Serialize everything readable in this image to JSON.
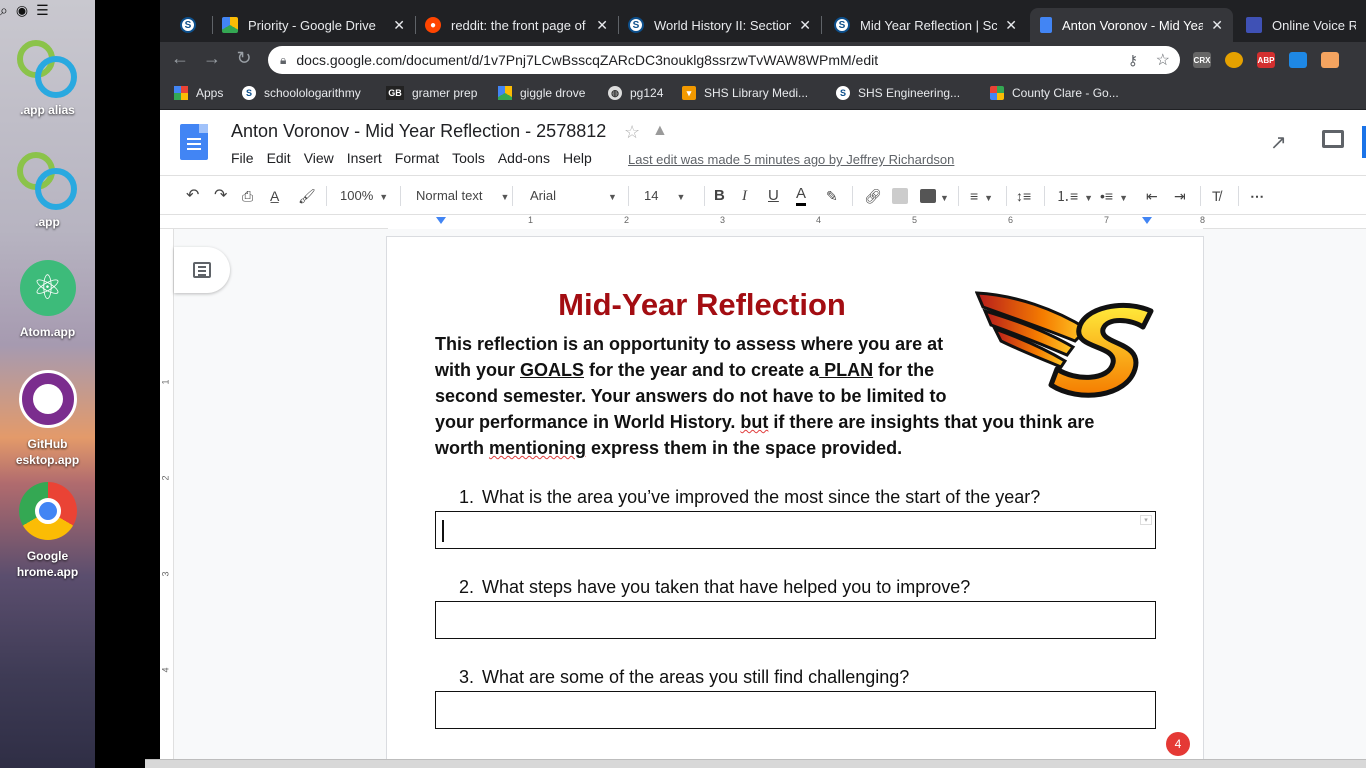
{
  "desktop": {
    "items": [
      {
        "label_1": ".app alias",
        "label_2": ""
      },
      {
        "label_1": ".app",
        "label_2": ""
      },
      {
        "label_1": "Atom.app",
        "label_2": ""
      },
      {
        "label_1": "GitHub",
        "label_2": "esktop.app"
      },
      {
        "label_1": "Google",
        "label_2": "hrome.app"
      }
    ]
  },
  "browser": {
    "tabs": [
      {
        "title": "",
        "icon": "schoology-icon"
      },
      {
        "title": "Priority - Google Drive",
        "icon": "google-drive-icon"
      },
      {
        "title": "reddit: the front page of t",
        "icon": "reddit-icon"
      },
      {
        "title": "World History II: Section",
        "icon": "schoology-icon"
      },
      {
        "title": "Mid Year Reflection | Sch",
        "icon": "schoology-icon"
      },
      {
        "title": "Anton Voronov - Mid Yea",
        "icon": "google-docs-icon"
      },
      {
        "title": "Online Voice Reco",
        "icon": "voice-recorder-icon"
      }
    ],
    "url": "docs.google.com/document/d/1v7Pnj7LCwBsscqZARcDC3nouklg8ssrzwTvWAW8WPmM/edit",
    "extensions": [
      "CRX",
      "",
      "ABP",
      "",
      ""
    ],
    "bookmarks": [
      {
        "label": "Apps",
        "icon": "apps-grid-icon"
      },
      {
        "label": "schoolologarithmy",
        "icon": "schoology-icon"
      },
      {
        "label": "gramer prep",
        "icon": "gb-icon"
      },
      {
        "label": "giggle drove",
        "icon": "google-drive-icon"
      },
      {
        "label": "pg124",
        "icon": "globe-icon"
      },
      {
        "label": "SHS Library Medi...",
        "icon": "library-icon"
      },
      {
        "label": "SHS Engineering...",
        "icon": "schoology-icon"
      },
      {
        "label": "County Clare - Go...",
        "icon": "google-maps-icon"
      }
    ]
  },
  "docs": {
    "title": "Anton Voronov - Mid Year Reflection - 2578812",
    "menu": [
      "File",
      "Edit",
      "View",
      "Insert",
      "Format",
      "Tools",
      "Add-ons",
      "Help"
    ],
    "last_edit": "Last edit was made 5 minutes ago by Jeffrey Richardson",
    "toolbar": {
      "zoom": "100%",
      "style": "Normal text",
      "font": "Arial",
      "size": "14",
      "bold": "B",
      "italic": "I",
      "underline": "U",
      "text_color": "A"
    },
    "ruler_numbers": [
      "1",
      "2",
      "3",
      "4",
      "5",
      "6",
      "7",
      "8"
    ],
    "vruler_numbers": [
      "1",
      "2",
      "3",
      "4"
    ]
  },
  "document": {
    "heading": "Mid-Year Reflection",
    "intro": {
      "p1": "This reflection is an opportunity to assess where you are at",
      "p2a": "with your ",
      "p2b": "GOALS",
      "p2c": " for the year and to create a",
      "p2d": " PLAN",
      "p2e": " for the",
      "p3": "second semester. Your answers do not have to be limited to",
      "p4a": "your performance in World History. ",
      "p4b": "but",
      "p4c": " if there are insights that you think are",
      "p5a": "worth ",
      "p5b": "mentioning",
      "p5c": " express them in the space provided."
    },
    "questions": [
      {
        "num": "1.",
        "text": "What is the area you’ve improved the most since the start of the year?"
      },
      {
        "num": "2.",
        "text": "What steps have you taken that have helped you to improve?"
      },
      {
        "num": "3.",
        "text": "What are some of the areas you still find challenging?"
      }
    ]
  },
  "notification": {
    "count": "4"
  },
  "colors": {
    "heading": "#a30d12",
    "docs_blue": "#4285f4",
    "tabstrip": "#202124",
    "toolbar": "#35363a"
  }
}
